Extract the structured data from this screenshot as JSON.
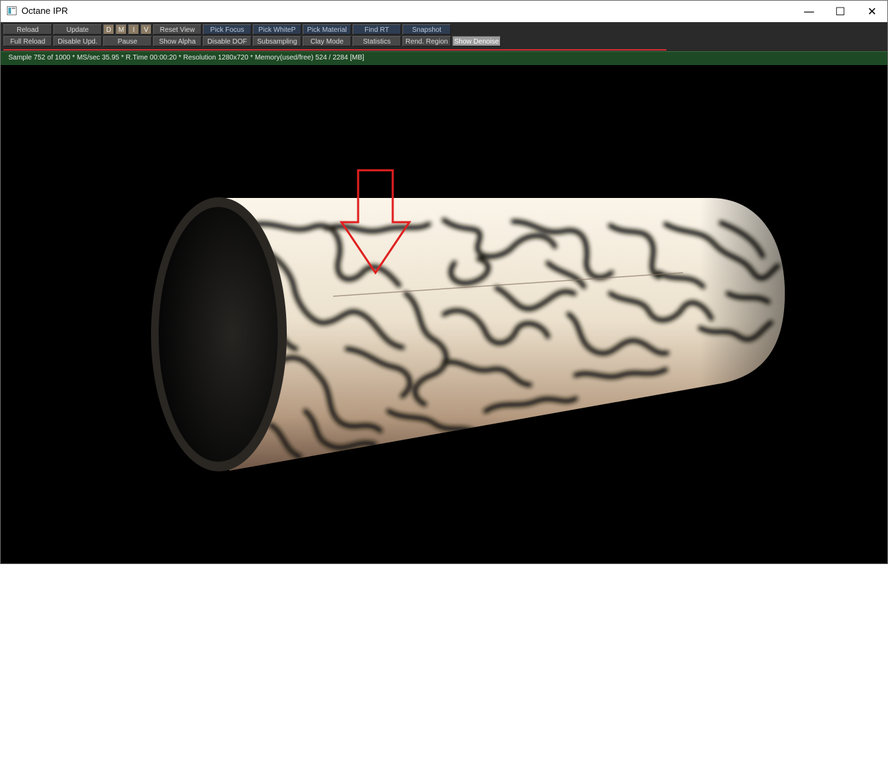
{
  "window": {
    "title": "Octane IPR",
    "controls": {
      "minimize": "—",
      "maximize": "☐",
      "close": "✕"
    }
  },
  "toolbar": {
    "row1": [
      {
        "label": "Reload",
        "style": "normal"
      },
      {
        "label": "Update",
        "style": "normal"
      },
      {
        "label": "D",
        "style": "tiny"
      },
      {
        "label": "M",
        "style": "tiny"
      },
      {
        "label": "I",
        "style": "tiny"
      },
      {
        "label": "V",
        "style": "tiny"
      },
      {
        "label": "Reset View",
        "style": "normal"
      },
      {
        "label": "Pick Focus",
        "style": "blue"
      },
      {
        "label": "Pick WhiteP",
        "style": "blue"
      },
      {
        "label": "Pick Material",
        "style": "blue"
      },
      {
        "label": "Find RT",
        "style": "blue"
      },
      {
        "label": "Snapshot",
        "style": "blue"
      }
    ],
    "row2": [
      {
        "label": "Full Reload",
        "style": "normal"
      },
      {
        "label": "Disable Upd.",
        "style": "normal"
      },
      {
        "label": "Pause",
        "style": "normal"
      },
      {
        "label": "Show Alpha",
        "style": "normal"
      },
      {
        "label": "Disable DOF",
        "style": "normal"
      },
      {
        "label": "Subsampling",
        "style": "normal"
      },
      {
        "label": "Clay Mode",
        "style": "normal"
      },
      {
        "label": "Statistics",
        "style": "normal"
      },
      {
        "label": "Rend. Region",
        "style": "normal"
      },
      {
        "label": "Show Denoise",
        "style": "on"
      }
    ]
  },
  "render": {
    "progress": 0.752,
    "status": "Sample 752 of 1000 * MS/sec 35.95 * R.Time 00:00:20 * Resolution 1280x720 * Memory(used/free) 524 / 2284 [MB]"
  },
  "viewport": {
    "content": "render-image",
    "annotation": "red-down-arrow"
  },
  "colors": {
    "toolbar_bg": "#2a2a2a",
    "status_bg": "#1d4a24",
    "progress": "#d03030",
    "annotation": "#e02020",
    "tube_surface": "#e9dfcc"
  }
}
